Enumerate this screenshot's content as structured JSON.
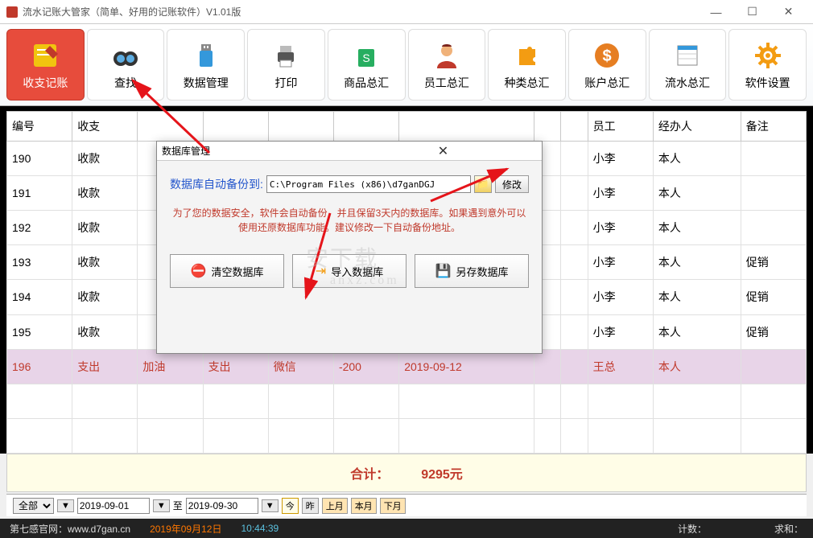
{
  "window": {
    "title": "流水记账大管家（简单、好用的记账软件）V1.01版",
    "min": "—",
    "max": "☐",
    "close": "✕"
  },
  "toolbar": [
    {
      "label": "收支记账",
      "icon": "note"
    },
    {
      "label": "查找",
      "icon": "binoc"
    },
    {
      "label": "数据管理",
      "icon": "usb"
    },
    {
      "label": "打印",
      "icon": "printer"
    },
    {
      "label": "商品总汇",
      "icon": "bag"
    },
    {
      "label": "员工总汇",
      "icon": "person"
    },
    {
      "label": "种类总汇",
      "icon": "puzzle"
    },
    {
      "label": "账户总汇",
      "icon": "dollar"
    },
    {
      "label": "流水总汇",
      "icon": "sheet"
    },
    {
      "label": "软件设置",
      "icon": "gear"
    }
  ],
  "columns": [
    "编号",
    "收支",
    "",
    "",
    "",
    "",
    "",
    "",
    "",
    "员工",
    "经办人",
    "备注"
  ],
  "rows": [
    {
      "c0": "190",
      "c1": "收款",
      "c2": "",
      "c3": "",
      "c4": "",
      "c5": "",
      "c6": "",
      "c7": "",
      "c8": "",
      "emp": "小李",
      "op": "本人",
      "note": ""
    },
    {
      "c0": "191",
      "c1": "收款",
      "c2": "",
      "c3": "",
      "c4": "",
      "c5": "",
      "c6": "",
      "c7": "",
      "c8": "",
      "emp": "小李",
      "op": "本人",
      "note": ""
    },
    {
      "c0": "192",
      "c1": "收款",
      "c2": "",
      "c3": "",
      "c4": "",
      "c5": "",
      "c6": "",
      "c7": "",
      "c8": "",
      "emp": "小李",
      "op": "本人",
      "note": ""
    },
    {
      "c0": "193",
      "c1": "收款",
      "c2": "",
      "c3": "",
      "c4": "",
      "c5": "",
      "c6": "",
      "c7": "",
      "c8": "",
      "emp": "小李",
      "op": "本人",
      "note": "促销"
    },
    {
      "c0": "194",
      "c1": "收款",
      "c2": "",
      "c3": "",
      "c4": "",
      "c5": "",
      "c6": "",
      "c7": "",
      "c8": "",
      "emp": "小李",
      "op": "本人",
      "note": "促销"
    },
    {
      "c0": "195",
      "c1": "收款",
      "c2": "",
      "c3": "",
      "c4": "",
      "c5": "",
      "c6": "",
      "c7": "",
      "c8": "",
      "emp": "小李",
      "op": "本人",
      "note": "促销"
    },
    {
      "c0": "196",
      "c1": "支出",
      "c2": "加油",
      "c3": "支出",
      "c4": "微信",
      "c5": "-200",
      "c6": "2019-09-12",
      "c7": "",
      "c8": "",
      "emp": "王总",
      "op": "本人",
      "note": "",
      "hl": true
    }
  ],
  "total": {
    "label": "合计：",
    "value": "9295元"
  },
  "filterbar": {
    "scope": "全部",
    "from": "2019-09-01",
    "to_lbl": "至",
    "to": "2019-09-30",
    "today": "今",
    "yest": "昨",
    "lastm": "上月",
    "thism": "本月",
    "nextm": "下月"
  },
  "status": {
    "site_lbl": "第七感官网：",
    "site": "www.d7gan.cn",
    "date": "2019年09月12日",
    "time": "10:44:39",
    "count_lbl": "计数：",
    "sum_lbl": "求和："
  },
  "modal": {
    "title": "数据库管理",
    "backup_lbl": "数据库自动备份到:",
    "path": "C:\\Program Files (x86)\\d7ganDGJ",
    "modify": "修改",
    "warn": "为了您的数据安全，软件会自动备份，并且保留3天内的数据库。如果遇到意外可以使用还原数据库功能。建议修改一下自动备份地址。",
    "clear": "清空数据库",
    "import": "导入数据库",
    "saveas": "另存数据库"
  }
}
